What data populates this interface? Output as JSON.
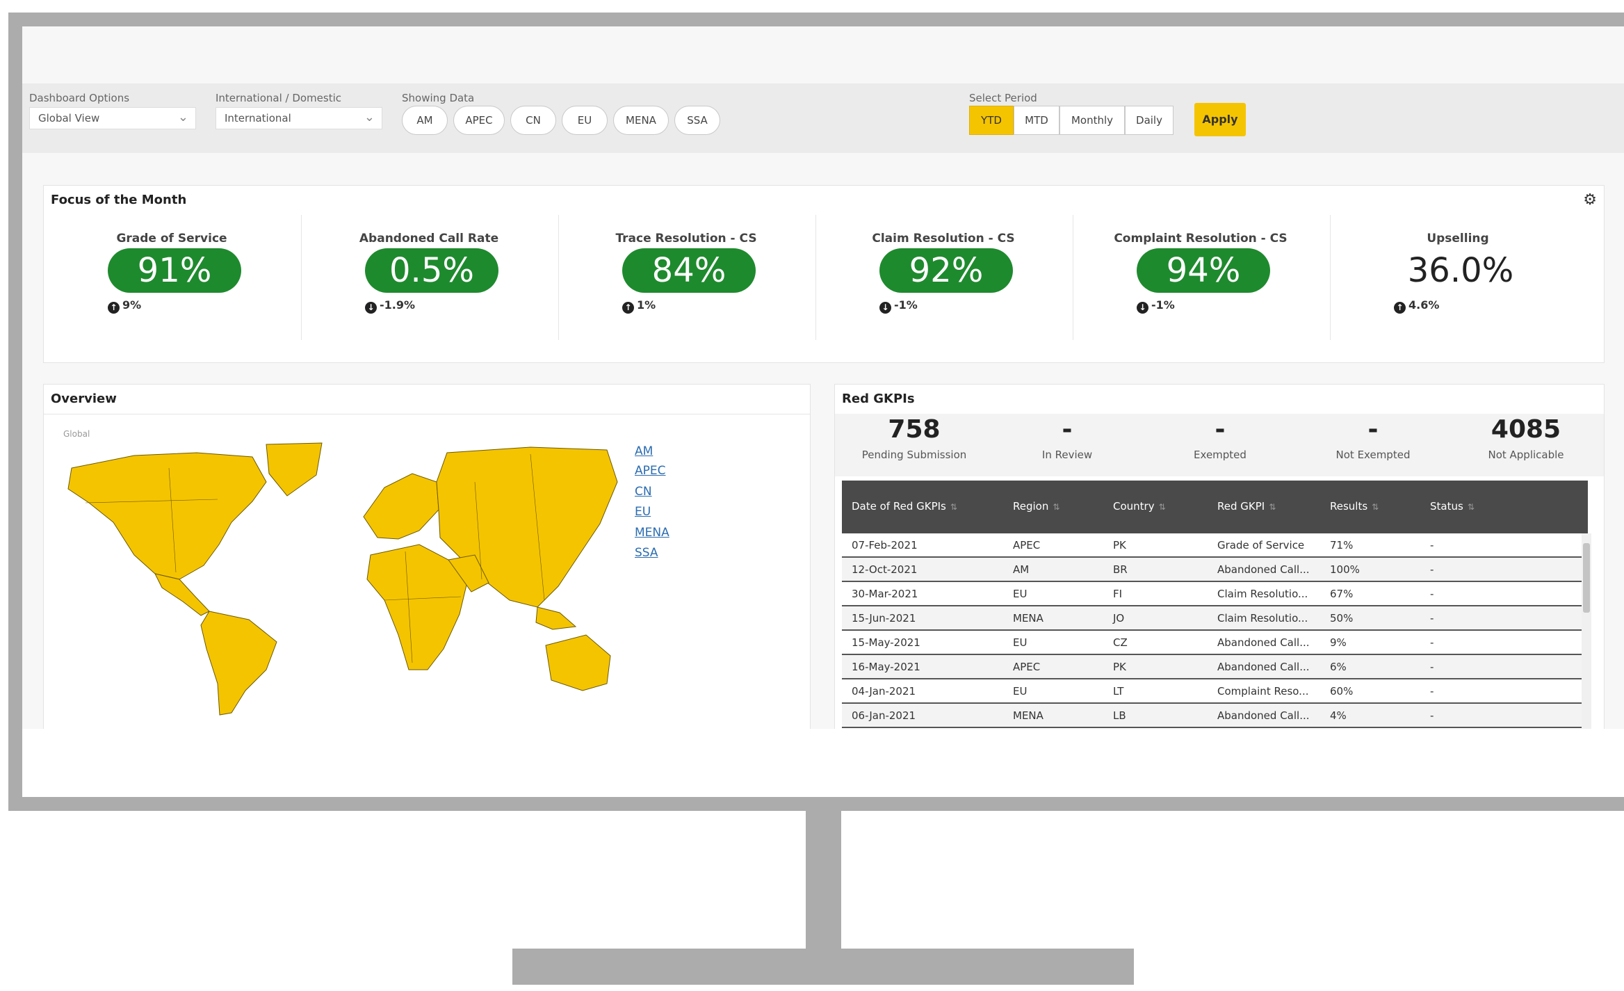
{
  "filters": {
    "dashboard_options": {
      "label": "Dashboard Options",
      "value": "Global View"
    },
    "intl_domestic": {
      "label": "International / Domestic",
      "value": "International"
    },
    "showing_data": {
      "label": "Showing Data",
      "regions": [
        "AM",
        "APEC",
        "CN",
        "EU",
        "MENA",
        "SSA"
      ]
    },
    "period": {
      "label": "Select Period",
      "options": [
        "YTD",
        "MTD",
        "Monthly",
        "Daily"
      ],
      "selected": "YTD"
    },
    "apply_label": "Apply"
  },
  "focus": {
    "title": "Focus of the Month",
    "kpis": [
      {
        "label": "Grade of Service",
        "value": "91%",
        "delta": "9%",
        "status": "green"
      },
      {
        "label": "Abandoned Call Rate",
        "value": "0.5%",
        "delta": "-1.9%",
        "status": "green"
      },
      {
        "label": "Trace Resolution - CS",
        "value": "84%",
        "delta": "1%",
        "status": "green"
      },
      {
        "label": "Claim Resolution - CS",
        "value": "92%",
        "delta": "-1%",
        "status": "green"
      },
      {
        "label": "Complaint Resolution - CS",
        "value": "94%",
        "delta": "-1%",
        "status": "green"
      },
      {
        "label": "Upselling",
        "value": "36.0%",
        "delta": "4.6%",
        "status": "none"
      }
    ]
  },
  "overview": {
    "title": "Overview",
    "map_label": "Global",
    "legend": [
      "AM",
      "APEC",
      "CN",
      "EU",
      "MENA",
      "SSA"
    ],
    "map_color": "#f5c400"
  },
  "red_gkpis": {
    "title": "Red GKPIs",
    "stats": [
      {
        "value": "758",
        "label": "Pending Submission"
      },
      {
        "value": "-",
        "label": "In Review"
      },
      {
        "value": "-",
        "label": "Exempted"
      },
      {
        "value": "-",
        "label": "Not Exempted"
      },
      {
        "value": "4085",
        "label": "Not Applicable"
      }
    ],
    "columns": [
      "Date of Red GKPIs",
      "Region",
      "Country",
      "Red GKPI",
      "Results",
      "Status"
    ],
    "rows": [
      [
        "07-Feb-2021",
        "APEC",
        "PK",
        "Grade of Service",
        "71%",
        "-"
      ],
      [
        "12-Oct-2021",
        "AM",
        "BR",
        "Abandoned Call...",
        "100%",
        "-"
      ],
      [
        "30-Mar-2021",
        "EU",
        "FI",
        "Claim Resolutio...",
        "67%",
        "-"
      ],
      [
        "15-Jun-2021",
        "MENA",
        "JO",
        "Claim Resolutio...",
        "50%",
        "-"
      ],
      [
        "15-May-2021",
        "EU",
        "CZ",
        "Abandoned Call...",
        "9%",
        "-"
      ],
      [
        "16-May-2021",
        "APEC",
        "PK",
        "Abandoned Call...",
        "6%",
        "-"
      ],
      [
        "04-Jan-2021",
        "EU",
        "LT",
        "Complaint Reso...",
        "60%",
        "-"
      ],
      [
        "06-Jan-2021",
        "MENA",
        "LB",
        "Abandoned Call...",
        "4%",
        "-"
      ]
    ]
  },
  "colors": {
    "accent": "#f5c400",
    "good": "#1e8a2e",
    "frame": "#acacac",
    "table_header": "#4a4a4a"
  }
}
